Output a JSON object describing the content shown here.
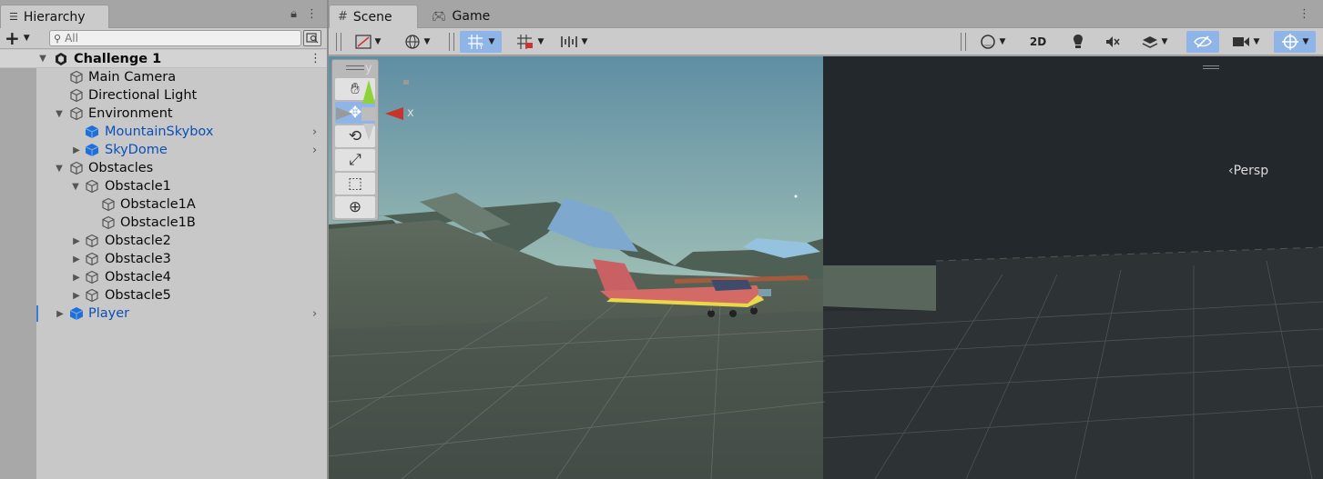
{
  "hierarchy": {
    "tab_label": "Hierarchy",
    "search_placeholder": "All",
    "scene_name": "Challenge 1",
    "items": [
      {
        "label": "Main Camera"
      },
      {
        "label": "Directional Light"
      },
      {
        "label": "Environment"
      },
      {
        "label": "MountainSkybox"
      },
      {
        "label": "SkyDome"
      },
      {
        "label": "Obstacles"
      },
      {
        "label": "Obstacle1"
      },
      {
        "label": "Obstacle1A"
      },
      {
        "label": "Obstacle1B"
      },
      {
        "label": "Obstacle2"
      },
      {
        "label": "Obstacle3"
      },
      {
        "label": "Obstacle4"
      },
      {
        "label": "Obstacle5"
      },
      {
        "label": "Player"
      }
    ]
  },
  "scene_view": {
    "tabs": [
      {
        "label": "Scene"
      },
      {
        "label": "Game"
      }
    ],
    "toolbar": {
      "mode_2d_label": "2D"
    },
    "gizmo": {
      "y_label": "y",
      "x_label": "x",
      "projection_label": "Persp"
    }
  },
  "colors": {
    "accent_blue": "#8fb5e8",
    "prefab_blue": "#0b4fb8",
    "panel_gray": "#c8c8c8"
  }
}
